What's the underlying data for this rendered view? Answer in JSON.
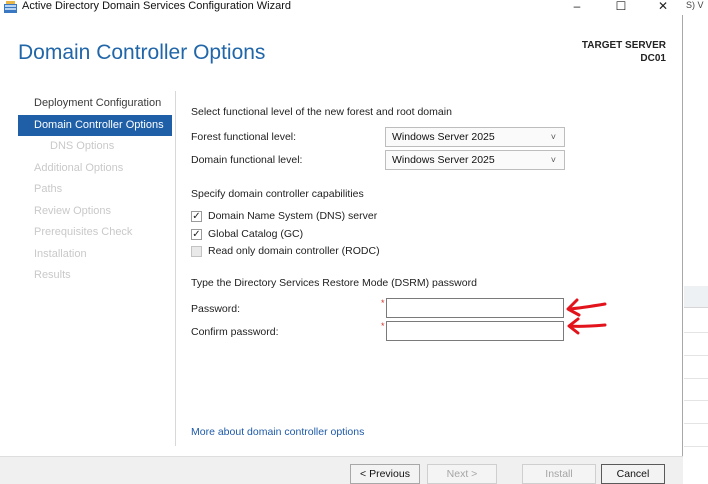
{
  "window": {
    "title": "Active Directory Domain Services Configuration Wizard",
    "minimize": "–",
    "maximize": "☐",
    "close": "✕"
  },
  "header": {
    "page_title": "Domain Controller Options",
    "target_label": "TARGET SERVER",
    "target_name": "DC01"
  },
  "nav": {
    "items": [
      {
        "label": "Deployment Configuration",
        "state": "enabled"
      },
      {
        "label": "Domain Controller Options",
        "state": "active"
      },
      {
        "label": "DNS Options",
        "state": "disabled",
        "sub": true
      },
      {
        "label": "Additional Options",
        "state": "disabled"
      },
      {
        "label": "Paths",
        "state": "disabled"
      },
      {
        "label": "Review Options",
        "state": "disabled"
      },
      {
        "label": "Prerequisites Check",
        "state": "disabled"
      },
      {
        "label": "Installation",
        "state": "disabled"
      },
      {
        "label": "Results",
        "state": "disabled"
      }
    ]
  },
  "functional_level": {
    "heading": "Select functional level of the new forest and root domain",
    "forest_label": "Forest functional level:",
    "forest_value": "Windows Server 2025",
    "domain_label": "Domain functional level:",
    "domain_value": "Windows Server 2025",
    "chevron": "˅"
  },
  "capabilities": {
    "heading": "Specify domain controller capabilities",
    "options": [
      {
        "label": "Domain Name System (DNS) server",
        "checked": true,
        "mark": "✓"
      },
      {
        "label": "Global Catalog (GC)",
        "checked": true,
        "mark": "✓"
      },
      {
        "label": "Read only domain controller (RODC)",
        "checked": false,
        "mark": ""
      }
    ]
  },
  "dsrm": {
    "heading": "Type the Directory Services Restore Mode (DSRM) password",
    "password_label": "Password:",
    "password_value": "",
    "confirm_label": "Confirm password:",
    "confirm_value": "",
    "required_marker": "*"
  },
  "link": {
    "text": "More about domain controller options"
  },
  "footer": {
    "previous": "< Previous",
    "next": "Next >",
    "install": "Install",
    "cancel": "Cancel"
  },
  "background_window": {
    "fragment": "S) V"
  },
  "colors": {
    "accent": "#1f5fa8",
    "title": "#2166a8",
    "link": "#1e5aa8",
    "required": "#d0342c",
    "annotation_arrow": "#e3131b"
  },
  "icons": {
    "app": "server-wizard-icon",
    "annotation": "red-hand-drawn-arrow-icon"
  }
}
